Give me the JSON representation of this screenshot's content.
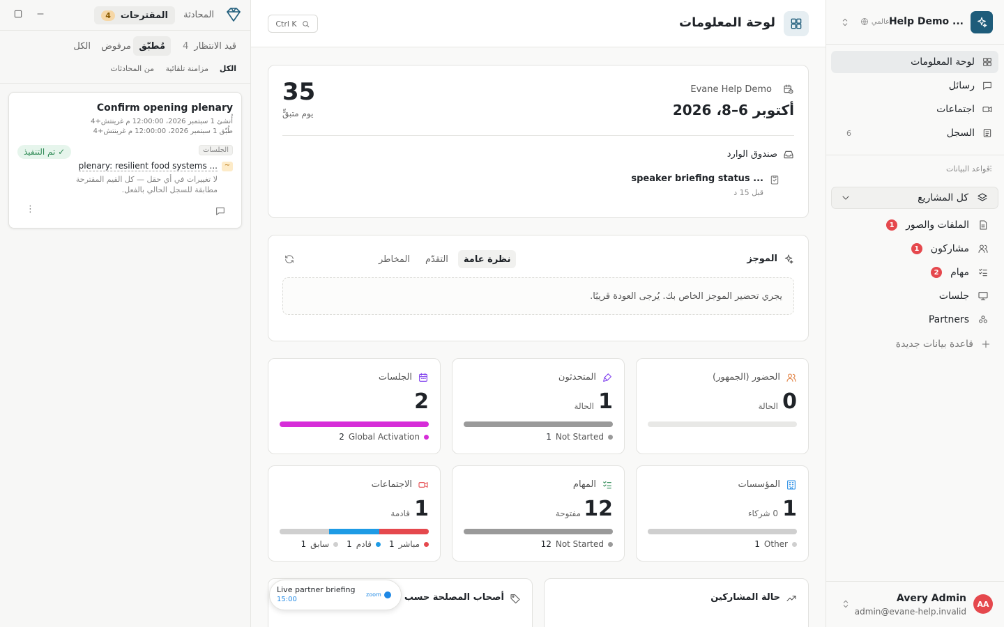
{
  "sidebar": {
    "workspace_name": "Help Demo ...",
    "workspace_scope": "عالمي",
    "nav": [
      {
        "label": "لوحة المعلومات",
        "icon": "dashboard-icon"
      },
      {
        "label": "رسائل",
        "icon": "message-icon"
      },
      {
        "label": "اجتماعات",
        "icon": "video-icon"
      },
      {
        "label": "السجل",
        "icon": "log-icon",
        "count": "6"
      }
    ],
    "databases_label": "قواعد البيانات",
    "all_projects": "كل المشاريع",
    "db_items": [
      {
        "label": "الملفات والصور",
        "badge": "1"
      },
      {
        "label": "مشاركون",
        "badge": "1"
      },
      {
        "label": "مهام",
        "badge": "2"
      },
      {
        "label": "جلسات",
        "badge": ""
      },
      {
        "label": "Partners",
        "badge": ""
      }
    ],
    "new_db": "قاعدة بيانات جديدة",
    "user": {
      "initials": "AA",
      "name": "Avery Admin",
      "email": "admin@evane-help.invalid"
    }
  },
  "left_panel": {
    "tab_conversation": "المحادثة",
    "tab_suggestions": "المقترحات",
    "suggestions_count": "4",
    "filters_row1": [
      {
        "label": "قيد الانتظار",
        "count": "4"
      },
      {
        "label": "مُطبّق",
        "active": true
      },
      {
        "label": "مرفوض"
      },
      {
        "label": "الكل"
      }
    ],
    "filters_row2": [
      {
        "label": "الكل",
        "active": true
      },
      {
        "label": "مزامنة تلقائية"
      },
      {
        "label": "من المحادثات"
      }
    ],
    "card": {
      "title": "Confirm opening plenary",
      "created": "أُنشئ 1 سبتمبر 2026، 12:00:00 م غرينتش+4",
      "applied": "طُبّق 1 سبتمبر 2026، 12:00:00 م غرينتش+4",
      "tag": "الجلسات",
      "status": "✓ تم التنفيذ",
      "value": "plenary: resilient food systems ...",
      "note": "لا تغييرات في أي حقل — كل القيم المقترحة مطابقة للسجل الحالي بالفعل."
    }
  },
  "main": {
    "title": "لوحة المعلومات",
    "search_shortcut": "Ctrl K",
    "event": {
      "org": "Evane Help Demo",
      "dates": "أكتوبر 6–8، 2026",
      "days": "35",
      "days_label": "يوم متبقٍّ",
      "inbox_label": "صندوق الوارد",
      "inbox_item": "speaker briefing status ...",
      "inbox_time": "قبل 15 د"
    },
    "brief": {
      "title": "الموجز",
      "tabs": [
        "نظرة عامة",
        "التقدّم",
        "المخاطر"
      ],
      "message": "يجري تحضير الموجز الخاص بك. يُرجى العودة قريبًا."
    },
    "stats": [
      {
        "title": "الحضور (الجمهور)",
        "num": "0",
        "sub": "الحالة",
        "icon": "audience-icon",
        "color": "#e07b39",
        "legend": []
      },
      {
        "title": "المتحدثون",
        "num": "1",
        "sub": "الحالة",
        "icon": "mic-icon",
        "color": "#7c3aed",
        "legend": [
          {
            "label": "Not Started",
            "num": "1",
            "color": "#9a9a9a"
          }
        ]
      },
      {
        "title": "الجلسات",
        "num": "2",
        "sub": "",
        "icon": "calendar-icon",
        "color": "#7c3aed",
        "legend": [
          {
            "label": "Global Activation",
            "num": "2",
            "color": "#d62dd8"
          }
        ]
      },
      {
        "title": "المؤسسات",
        "num": "1",
        "sub": "0 شركاء",
        "icon": "building-icon",
        "color": "#1e88e5",
        "legend": [
          {
            "label": "Other",
            "num": "1",
            "color": "#cfcfcf"
          }
        ]
      },
      {
        "title": "المهام",
        "num": "12",
        "sub": "مفتوحة",
        "icon": "tasks-icon",
        "color": "#2f8a55",
        "legend": [
          {
            "label": "Not Started",
            "num": "12",
            "color": "#9a9a9a"
          }
        ]
      },
      {
        "title": "الاجتماعات",
        "num": "1",
        "sub": "قادمة",
        "icon": "video-icon",
        "color": "#e5484d",
        "legend": [
          {
            "label": "مباشر",
            "num": "1",
            "color": "#e5484d"
          },
          {
            "label": "قادم",
            "num": "1",
            "color": "#1e9be5"
          },
          {
            "label": "سابق",
            "num": "1",
            "color": "#cfcfcf"
          }
        ]
      }
    ],
    "bottom_left_title": "أصحاب المصلحة حسب الـ",
    "bottom_right_title": "حالة المشاركين",
    "toast": {
      "title": "Live partner briefing",
      "time": "15:00",
      "zoom": "zoom"
    }
  }
}
